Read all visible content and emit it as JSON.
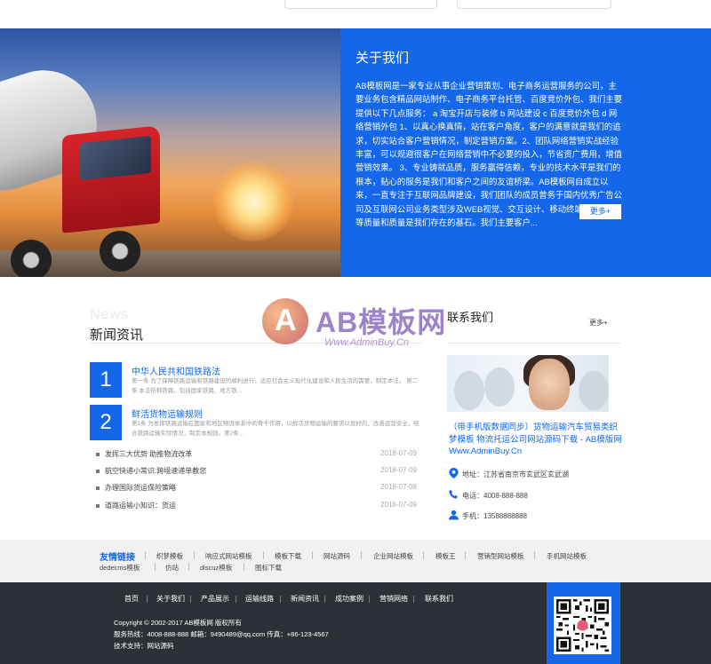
{
  "about": {
    "title": "关于我们",
    "text": "AB模板网是一家专业从事企业营销策划、电子商务运营服务的公司，主要业务包含精品网站制作、电子商务平台托管、百度竞价外包、我们主要提供以下几点服务： a 淘宝开店与装修 b 网站建设 c 百度竞价外包 d 网络营销外包 1、以真心换真情，站在客户角度，客户的满意就是我们的追求，切实站合客户营销情况，制定营销方案。2、团队网络营销实战经验丰富，可以规避很客户在网络营销中不必要的投入，节省资广费用，增值营销效果。 3、专业铸就品质，服务赢得信赖，专业的技术水平是我们的根本，贴心的服务是我们和客户之间的友谊桥梁。AB模板网自成立以来，一直专注于互联网品牌建设，我们团队的成员曾务于国内优秀广告公司及互联网公司业务类型涉及WEB视觉、交互设计、移动终端用户体验等质量和质量是我们存在的基石。我们主要客户...",
    "more_label": "更多+"
  },
  "news": {
    "bg_word": "News",
    "title": "新闻资讯",
    "featured": [
      {
        "num": "1",
        "title": "中华人民共和国铁路法",
        "desc": "第一条 为了保障铁路运输和铁路建设的顺利进行，适应社会主义现代化建设和人民生活的需要，制定本法。 第二条 本法所称铁路，包括国家铁路、地方铁..."
      },
      {
        "num": "2",
        "title": "鲜活货物运输规则",
        "desc": "第1条 为发挥铁路运输在国家和地区物流体系中的骨干作用，以鲜活货物运输的要求以良好的，改善运营安全，结合铁路运输实际情况，制定本规则。第2条..."
      }
    ],
    "items": [
      {
        "title": "发挥三大优势 助推物流改革",
        "date": "2018-07-09"
      },
      {
        "title": "航空快递小常识:跨境速递单教您",
        "date": "2018-07-09"
      },
      {
        "title": "办理国际货运保险策略",
        "date": "2018-07-09"
      },
      {
        "title": "道路运输小知识：货运",
        "date": "2018-07-09"
      }
    ]
  },
  "watermark": {
    "brand": "AB模板网",
    "url": "Www.AdminBuy.Cn"
  },
  "contact": {
    "title": "联系我们",
    "more_label": "更多+",
    "link_text": "（带手机版数据同步）货物运输汽车贸易类织梦模板 物流托运公司网站源码下载 - AB模版网 Www.AdminBuy.Cn",
    "address": "地址：江苏省南京市玄武区玄武湖",
    "phone": "电话：4008-888-888",
    "mobile": "手机：13588888888"
  },
  "friend_links": {
    "label": "友情链接",
    "items": [
      "织梦模板",
      "响应式网站模板",
      "模板下载",
      "网站源码",
      "企业网站模板",
      "模板王",
      "营销型网站模板",
      "手机网站模板",
      "dedecms模板",
      "仿站",
      "discuz模板",
      "图标下载"
    ]
  },
  "footer": {
    "nav": [
      "首页",
      "关于我们",
      "产品展示",
      "运输线路",
      "新闻资讯",
      "成功案例",
      "营销网络",
      "联系我们"
    ],
    "copyright": "Copyright © 2002-2017 AB模板网 版权所有",
    "hotline": "服务热线：4008-888-888 邮箱：9490489@qq.com 传真：+86-123-4567",
    "support": "技术支持：网站源码"
  },
  "colors": {
    "accent": "#1367e8",
    "footer_bg": "#2c3138",
    "links_bg": "#f1f1f1"
  },
  "icons": {
    "address": "map-pin-icon",
    "phone": "phone-icon",
    "mobile": "user-icon"
  }
}
